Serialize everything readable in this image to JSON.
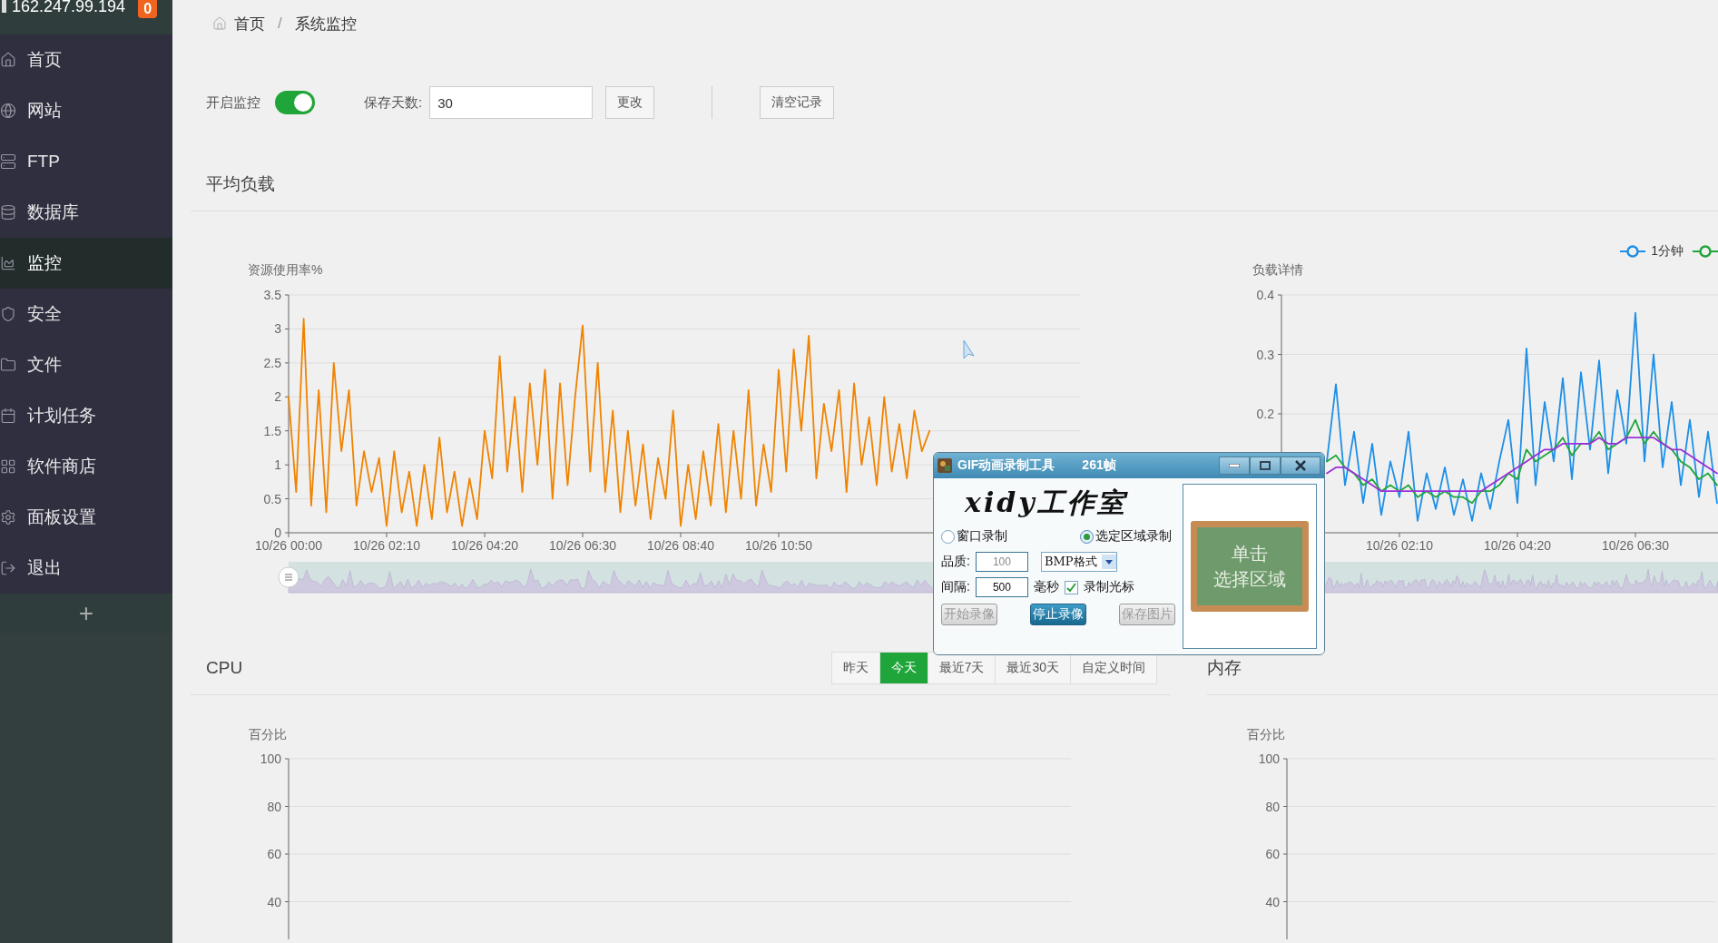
{
  "sidebar": {
    "host": "162.247.99.194",
    "badge": "0",
    "items": [
      {
        "label": "首页",
        "selected": false
      },
      {
        "label": "网站",
        "selected": false
      },
      {
        "label": "FTP",
        "selected": false
      },
      {
        "label": "数据库",
        "selected": false
      },
      {
        "label": "监控",
        "selected": true
      },
      {
        "label": "安全",
        "selected": false
      },
      {
        "label": "文件",
        "selected": false
      },
      {
        "label": "计划任务",
        "selected": false
      },
      {
        "label": "软件商店",
        "selected": false
      },
      {
        "label": "面板设置",
        "selected": false
      },
      {
        "label": "退出",
        "selected": false
      }
    ],
    "add": "+"
  },
  "breadcrumb": {
    "items": [
      "首页",
      "系统监控"
    ],
    "separator": "/"
  },
  "controls": {
    "monitor_label": "开启监控",
    "monitor_on": true,
    "days_label": "保存天数:",
    "days_value": "30",
    "change_button": "更改",
    "clear_button": "清空记录"
  },
  "load": {
    "title": "平均负载",
    "legend": [
      {
        "label": "1分钟",
        "color": "#1e8fe6"
      },
      {
        "color": "#20a53a"
      }
    ],
    "usage_chart": {
      "chart_data": {
        "type": "line",
        "ylabel": "资源使用率%",
        "grid": true,
        "ylim": [
          0,
          3.5
        ],
        "yticks": [
          3.5,
          3,
          2.5,
          2,
          1.5,
          1,
          0.5,
          0
        ],
        "categories": [
          "10/26 00:00",
          null,
          null,
          null,
          null,
          null,
          null,
          null,
          null,
          null,
          null,
          null,
          null,
          "10/26 02:10",
          null,
          null,
          null,
          null,
          null,
          null,
          null,
          null,
          null,
          null,
          null,
          null,
          "10/26 04:20",
          null,
          null,
          null,
          null,
          null,
          null,
          null,
          null,
          null,
          null,
          null,
          null,
          "10/26 06:30",
          null,
          null,
          null,
          null,
          null,
          null,
          null,
          null,
          null,
          null,
          null,
          null,
          "10/26 08:40",
          null,
          null,
          null,
          null,
          null,
          null,
          null,
          null,
          null,
          null,
          null,
          null,
          "10/26 10:50",
          null,
          null,
          null,
          null,
          null,
          null,
          null,
          null,
          null,
          null,
          null,
          null,
          null,
          null,
          null,
          null,
          null,
          null,
          null,
          null
        ],
        "series": [
          {
            "color": "#f08300",
            "values": [
              2.0,
              0.6,
              3.15,
              0.4,
              2.1,
              0.3,
              2.5,
              1.2,
              2.1,
              0.4,
              1.2,
              0.6,
              1.1,
              0.1,
              1.2,
              0.3,
              0.9,
              0.1,
              1.0,
              0.2,
              1.4,
              0.3,
              0.9,
              0.1,
              0.8,
              0.2,
              1.5,
              0.8,
              2.6,
              0.9,
              2.0,
              0.6,
              2.2,
              1.0,
              2.4,
              0.5,
              2.2,
              0.7,
              2.0,
              3.05,
              0.9,
              2.5,
              0.6,
              1.8,
              0.3,
              1.5,
              0.4,
              1.3,
              0.2,
              1.1,
              0.5,
              1.8,
              0.1,
              1.0,
              0.2,
              1.2,
              0.4,
              1.6,
              0.3,
              1.5,
              0.5,
              2.1,
              0.4,
              1.3,
              0.6,
              2.4,
              0.9,
              2.7,
              1.5,
              2.9,
              0.8,
              1.9,
              1.2,
              2.1,
              0.6,
              2.2,
              1.0,
              1.7,
              0.7,
              2.0,
              0.9,
              1.6,
              0.8,
              1.8,
              1.2,
              1.5
            ]
          }
        ]
      }
    },
    "detail_chart": {
      "chart_data": {
        "type": "line",
        "ylabel": "负载详情",
        "grid": true,
        "ylim": [
          0,
          0.4
        ],
        "yticks": [
          0.4,
          0.3,
          0.2
        ],
        "categories": [
          null,
          null,
          null,
          null,
          null,
          null,
          null,
          null,
          null,
          null,
          null,
          null,
          null,
          "10/26 02:10",
          null,
          null,
          null,
          null,
          null,
          null,
          null,
          null,
          null,
          null,
          null,
          null,
          "10/26 04:20",
          null,
          null,
          null,
          null,
          null,
          null,
          null,
          null,
          null,
          null,
          null,
          null,
          "10/26 06:30",
          null,
          null,
          null,
          null,
          null,
          null,
          null,
          null,
          null
        ],
        "series": [
          {
            "color": "#1e8fe6",
            "values": [
              null,
              null,
              null,
              null,
              null,
              0.12,
              0.25,
              0.08,
              0.17,
              0.05,
              0.15,
              0.03,
              0.12,
              0.06,
              0.17,
              0.02,
              0.1,
              0.04,
              0.11,
              0.03,
              0.09,
              0.02,
              0.1,
              0.04,
              0.12,
              0.19,
              0.05,
              0.31,
              0.08,
              0.22,
              0.12,
              0.26,
              0.09,
              0.27,
              0.14,
              0.29,
              0.1,
              0.24,
              0.15,
              0.37,
              0.12,
              0.3,
              0.11,
              0.22,
              0.08,
              0.19,
              0.06,
              0.17,
              0.05
            ]
          },
          {
            "color": "#20a53a",
            "values": [
              null,
              null,
              null,
              null,
              null,
              0.12,
              0.13,
              0.11,
              0.1,
              0.08,
              0.09,
              0.07,
              0.08,
              0.07,
              0.08,
              0.06,
              0.07,
              0.06,
              0.07,
              0.06,
              0.06,
              0.05,
              0.07,
              0.07,
              0.08,
              0.1,
              0.09,
              0.14,
              0.12,
              0.13,
              0.14,
              0.16,
              0.13,
              0.15,
              0.15,
              0.17,
              0.14,
              0.15,
              0.16,
              0.19,
              0.15,
              0.17,
              0.15,
              0.14,
              0.12,
              0.11,
              0.09,
              0.1,
              0.08
            ]
          },
          {
            "color": "#9b30d9",
            "values": [
              null,
              null,
              null,
              null,
              null,
              0.1,
              0.11,
              0.11,
              0.1,
              0.09,
              0.08,
              0.07,
              0.07,
              0.07,
              0.07,
              0.07,
              0.07,
              0.07,
              0.07,
              0.07,
              0.07,
              0.07,
              0.07,
              0.08,
              0.09,
              0.1,
              0.11,
              0.12,
              0.13,
              0.14,
              0.14,
              0.15,
              0.15,
              0.15,
              0.15,
              0.16,
              0.15,
              0.15,
              0.16,
              0.16,
              0.16,
              0.16,
              0.15,
              0.14,
              0.14,
              0.13,
              0.12,
              0.11,
              0.1
            ]
          }
        ]
      }
    }
  },
  "cpu": {
    "title": "CPU",
    "tabs": [
      {
        "label": "昨天",
        "selected": false
      },
      {
        "label": "今天",
        "selected": true
      },
      {
        "label": "最近7天",
        "selected": false
      },
      {
        "label": "最近30天",
        "selected": false
      },
      {
        "label": "自定义时间",
        "selected": false
      }
    ],
    "ylabel": "百分比",
    "yticks": [
      "100",
      "80",
      "60",
      "40"
    ]
  },
  "memory": {
    "title": "内存",
    "ylabel": "百分比",
    "yticks": [
      "100",
      "80",
      "60",
      "40"
    ]
  },
  "recorder": {
    "title": "GIF动画录制工具",
    "frames": "261帧",
    "logo": "xidy工作室",
    "modes": [
      {
        "label": "窗口录制",
        "selected": false
      },
      {
        "label": "选定区域录制",
        "selected": true
      }
    ],
    "quality_label": "品质:",
    "quality_value": "100",
    "format": "BMP格式",
    "interval_label": "间隔:",
    "interval_value": "500",
    "interval_unit": "毫秒",
    "cursor_label": "录制光标",
    "cursor_checked": true,
    "buttons": [
      {
        "label": "开始录像",
        "disabled": true,
        "primary": false
      },
      {
        "label": "停止录像",
        "disabled": false,
        "primary": true
      },
      {
        "label": "保存图片",
        "disabled": true,
        "primary": false
      }
    ],
    "board_lines": [
      "单击",
      "选择区域"
    ]
  }
}
